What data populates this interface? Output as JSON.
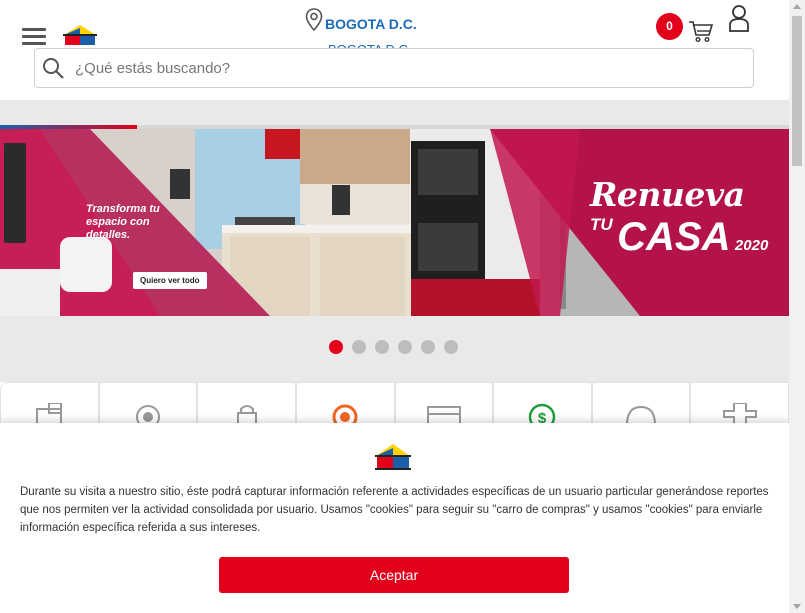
{
  "header": {
    "location_name": "BOGOTA D.C.",
    "location_sub": "BOGOTA D.C.",
    "cart_count": "0",
    "brand_colors": {
      "red": "#e3001b",
      "blue": "#1b5fa8",
      "yellow": "#ffd200"
    }
  },
  "search": {
    "placeholder": "¿Qué estás buscando?",
    "value": ""
  },
  "banner": {
    "left_text": "Transforma tu espacio con detalles.",
    "cta_label": "Quiero ver todo",
    "headline": "Renueva",
    "sub_tu": "TU",
    "sub_casa": "CASA",
    "year": "2020",
    "slide_count": 6,
    "active_slide": 1
  },
  "categories": {
    "icons": [
      "furniture-icon",
      "target-icon",
      "lock-icon",
      "circle-icon",
      "appliance-icon",
      "dollar-icon",
      "refresh-icon",
      "plus-icon"
    ]
  },
  "cookie": {
    "text": "Durante su visita a nuestro sitio, éste podrá capturar información referente a actividades específicas de un usuario particular generándose reportes que nos permiten ver la actividad consolidada por usuario. Usamos \"cookies\" para seguir su \"carro de compras\" y usamos \"cookies\" para enviarle información específica referida a sus intereses.",
    "accept_label": "Aceptar"
  }
}
